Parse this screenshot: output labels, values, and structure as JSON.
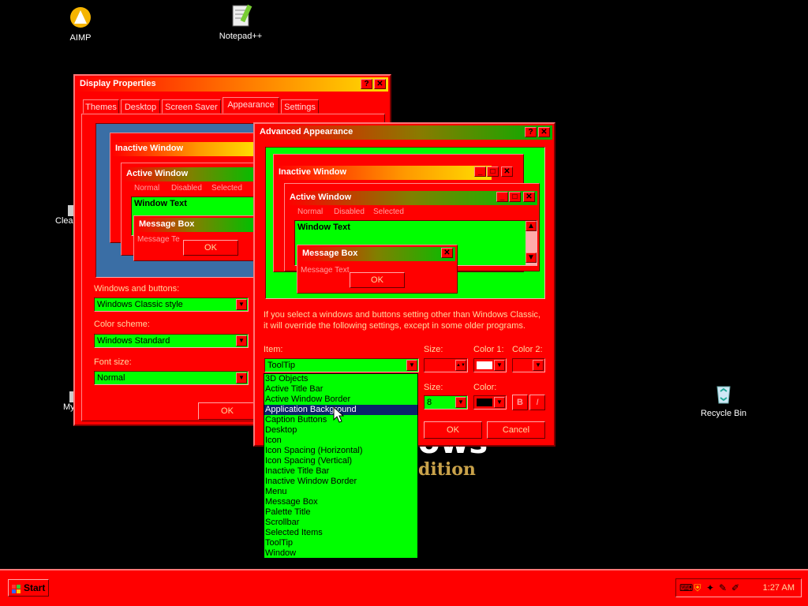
{
  "desktop": {
    "icons": [
      {
        "label": "AIMP"
      },
      {
        "label": "Notepad++"
      },
      {
        "label": "Recycle Bin"
      },
      {
        "label": "Clea"
      },
      {
        "label": "My"
      }
    ],
    "wallpaper_text": "ows",
    "wallpaper_sub": "dition"
  },
  "display_properties": {
    "title": "Display Properties",
    "help_btn": "?",
    "close_btn": "✕",
    "tabs": [
      "Themes",
      "Desktop",
      "Screen Saver",
      "Appearance",
      "Settings"
    ],
    "preview": {
      "inactive": "Inactive Window",
      "active": "Active Window",
      "menu": [
        "Normal",
        "Disabled",
        "Selected"
      ],
      "window_text": "Window Text",
      "message_box": "Message Box",
      "message_text": "Message Te",
      "ok": "OK"
    },
    "windows_buttons_label": "Windows and buttons:",
    "windows_buttons_value": "Windows Classic style",
    "color_scheme_label": "Color scheme:",
    "color_scheme_value": "Windows Standard",
    "font_size_label": "Font size:",
    "font_size_value": "Normal",
    "ok": "OK"
  },
  "advanced": {
    "title": "Advanced Appearance",
    "help_btn": "?",
    "close_btn": "✕",
    "preview": {
      "inactive": "Inactive Window",
      "active": "Active Window",
      "menu": [
        "Normal",
        "Disabled",
        "Selected"
      ],
      "window_text": "Window Text",
      "message_box": "Message Box",
      "message_text": "Message Text",
      "ok": "OK"
    },
    "info_line1": "If you select a windows and buttons setting other than Windows Classic,",
    "info_line2": "it will override the following settings, except in some older programs.",
    "item_label": "Item:",
    "item_value": "ToolTip",
    "size_label": "Size:",
    "color1_label": "Color 1:",
    "color2_label": "Color 2:",
    "font_size_label": "Size:",
    "font_size_value": "8",
    "font_color_label": "Color:",
    "bold": "B",
    "italic": "I",
    "ok": "OK",
    "cancel": "Cancel",
    "dropdown_items": [
      "3D Objects",
      "Active Title Bar",
      "Active Window Border",
      "Application Background",
      "Caption Buttons",
      "Desktop",
      "Icon",
      "Icon Spacing (Horizontal)",
      "Icon Spacing (Vertical)",
      "Inactive Title Bar",
      "Inactive Window Border",
      "Menu",
      "Message Box",
      "Palette Title",
      "Scrollbar",
      "Selected Items",
      "ToolTip",
      "Window"
    ],
    "selected_index": 3
  },
  "taskbar": {
    "start": "Start",
    "clock": "1:27 AM"
  },
  "colors": {
    "window_face": "#ff0000",
    "window_bg": "#00ff00",
    "selection": "#0a246a",
    "desktop": "#000000"
  }
}
